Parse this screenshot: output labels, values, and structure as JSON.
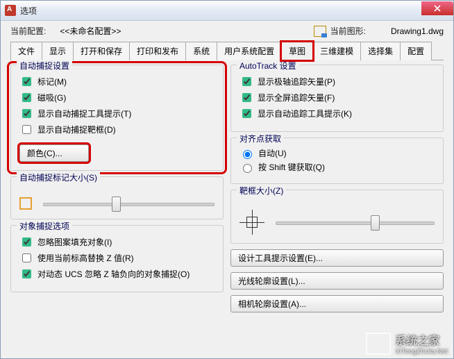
{
  "title": "选项",
  "info": {
    "profile_label": "当前配置:",
    "profile_value": "<<未命名配置>>",
    "drawing_label": "当前图形:",
    "drawing_value": "Drawing1.dwg"
  },
  "tabs": [
    "文件",
    "显示",
    "打开和保存",
    "打印和发布",
    "系统",
    "用户系统配置",
    "草图",
    "三维建模",
    "选择集",
    "配置"
  ],
  "active_tab": "草图",
  "left": {
    "autosnap": {
      "title": "自动捕捉设置",
      "marker": "标记(M)",
      "magnet": "磁吸(G)",
      "tooltip": "显示自动捕捉工具提示(T)",
      "aperture": "显示自动捕捉靶框(D)",
      "color_btn": "颜色(C)..."
    },
    "marker_size": {
      "title": "自动捕捉标记大小(S)"
    },
    "snap_opts": {
      "title": "对象捕捉选项",
      "ignore_hatch": "忽略图案填充对象(I)",
      "replace_z": "使用当前标高替换 Z 值(R)",
      "ignore_neg_z": "对动态 UCS 忽略 Z 轴负向的对象捕捉(O)"
    }
  },
  "right": {
    "autotrack": {
      "title": "AutoTrack 设置",
      "polar": "显示极轴追踪矢量(P)",
      "full": "显示全屏追踪矢量(F)",
      "tooltip": "显示自动追踪工具提示(K)"
    },
    "align": {
      "title": "对齐点获取",
      "auto": "自动(U)",
      "shift": "按 Shift 键获取(Q)"
    },
    "aperture_size": {
      "title": "靶框大小(Z)"
    },
    "design_btn": "设计工具提示设置(E)...",
    "light_btn": "光线轮廓设置(L)...",
    "camera_btn": "相机轮廓设置(A)..."
  },
  "watermark": {
    "brand": "系统之家",
    "url": "XiTongZhiJia.Net"
  }
}
